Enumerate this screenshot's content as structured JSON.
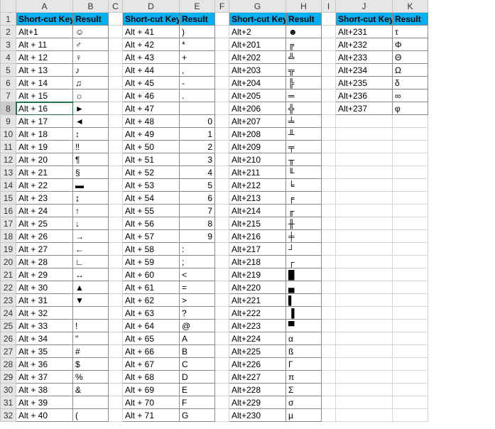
{
  "columns": [
    "A",
    "B",
    "C",
    "D",
    "E",
    "F",
    "G",
    "H",
    "I",
    "J",
    "K"
  ],
  "header_label_key": "Short-cut Key",
  "header_label_result": "Result",
  "selected_row": 8,
  "selected_col": "A",
  "blocks": [
    {
      "keycol": "A",
      "rescol": "B",
      "rows": [
        [
          "Alt+1",
          "☺"
        ],
        [
          "Alt + 11",
          "♂"
        ],
        [
          "Alt + 12",
          "♀"
        ],
        [
          "Alt + 13",
          "♪"
        ],
        [
          "Alt + 14",
          "♫"
        ],
        [
          "Alt + 15",
          "☼"
        ],
        [
          "Alt + 16",
          "►"
        ],
        [
          "Alt + 17",
          "◄"
        ],
        [
          "Alt + 18",
          "↕"
        ],
        [
          "Alt + 19",
          "‼"
        ],
        [
          "Alt + 20",
          "¶"
        ],
        [
          "Alt + 21",
          "§"
        ],
        [
          "Alt + 22",
          "▬"
        ],
        [
          "Alt + 23",
          "↨"
        ],
        [
          "Alt + 24",
          "↑"
        ],
        [
          "Alt + 25",
          "↓"
        ],
        [
          "Alt + 26",
          "→"
        ],
        [
          "Alt + 27",
          "←"
        ],
        [
          "Alt + 28",
          "∟"
        ],
        [
          "Alt + 29",
          "↔"
        ],
        [
          "Alt + 30",
          "▲"
        ],
        [
          "Alt + 31",
          "▼"
        ],
        [
          "Alt + 32",
          ""
        ],
        [
          "Alt + 33",
          "!"
        ],
        [
          "Alt + 34",
          "\""
        ],
        [
          "Alt + 35",
          "#"
        ],
        [
          "Alt + 36",
          "$"
        ],
        [
          "Alt + 37",
          "%"
        ],
        [
          "Alt + 38",
          "&"
        ],
        [
          "Alt + 39",
          ""
        ],
        [
          "Alt + 40",
          "("
        ]
      ]
    },
    {
      "keycol": "D",
      "rescol": "E",
      "rows": [
        [
          "Alt + 41",
          ")"
        ],
        [
          "Alt + 42",
          "*"
        ],
        [
          "Alt + 43",
          "+"
        ],
        [
          "Alt + 44",
          ","
        ],
        [
          "Alt + 45",
          "-"
        ],
        [
          "Alt + 46",
          "."
        ],
        [
          "Alt + 47",
          ""
        ],
        [
          "Alt + 48",
          "0"
        ],
        [
          "Alt + 49",
          "1"
        ],
        [
          "Alt + 50",
          "2"
        ],
        [
          "Alt + 51",
          "3"
        ],
        [
          "Alt + 52",
          "4"
        ],
        [
          "Alt + 53",
          "5"
        ],
        [
          "Alt + 54",
          "6"
        ],
        [
          "Alt + 55",
          "7"
        ],
        [
          "Alt + 56",
          "8"
        ],
        [
          "Alt + 57",
          "9"
        ],
        [
          "Alt + 58",
          ":"
        ],
        [
          "Alt + 59",
          ";"
        ],
        [
          "Alt + 60",
          "<"
        ],
        [
          "Alt + 61",
          "="
        ],
        [
          "Alt + 62",
          ">"
        ],
        [
          "Alt + 63",
          "?"
        ],
        [
          "Alt + 64",
          "@"
        ],
        [
          "Alt + 65",
          "A"
        ],
        [
          "Alt + 66",
          "B"
        ],
        [
          "Alt + 67",
          "C"
        ],
        [
          "Alt + 68",
          "D"
        ],
        [
          "Alt + 69",
          "E"
        ],
        [
          "Alt + 70",
          "F"
        ],
        [
          "Alt + 71",
          "G"
        ]
      ]
    },
    {
      "keycol": "G",
      "rescol": "H",
      "rows": [
        [
          "Alt+2",
          "☻"
        ],
        [
          "Alt+201",
          "╔"
        ],
        [
          "Alt+202",
          "╩"
        ],
        [
          "Alt+203",
          "╦"
        ],
        [
          "Alt+204",
          "╠"
        ],
        [
          "Alt+205",
          "═"
        ],
        [
          "Alt+206",
          "╬"
        ],
        [
          "Alt+207",
          "╧"
        ],
        [
          "Alt+208",
          "╨"
        ],
        [
          "Alt+209",
          "╤"
        ],
        [
          "Alt+210",
          "╥"
        ],
        [
          "Alt+211",
          "╙"
        ],
        [
          "Alt+212",
          "╘"
        ],
        [
          "Alt+213",
          "╒"
        ],
        [
          "Alt+214",
          "╓"
        ],
        [
          "Alt+215",
          "╫"
        ],
        [
          "Alt+216",
          "╪"
        ],
        [
          "Alt+217",
          "┘"
        ],
        [
          "Alt+218",
          "┌"
        ],
        [
          "Alt+219",
          "█"
        ],
        [
          "Alt+220",
          "▄"
        ],
        [
          "Alt+221",
          "▌"
        ],
        [
          "Alt+222",
          "▐"
        ],
        [
          "Alt+223",
          "▀"
        ],
        [
          "Alt+224",
          "α"
        ],
        [
          "Alt+225",
          "ß"
        ],
        [
          "Alt+226",
          "Γ"
        ],
        [
          "Alt+227",
          "π"
        ],
        [
          "Alt+228",
          "Σ"
        ],
        [
          "Alt+229",
          "σ"
        ],
        [
          "Alt+230",
          "µ"
        ]
      ]
    },
    {
      "keycol": "J",
      "rescol": "K",
      "rows": [
        [
          "Alt+231",
          "τ"
        ],
        [
          "Alt+232",
          "Φ"
        ],
        [
          "Alt+233",
          "Θ"
        ],
        [
          "Alt+234",
          "Ω"
        ],
        [
          "Alt+235",
          "δ"
        ],
        [
          "Alt+236",
          "∞"
        ],
        [
          "Alt+237",
          "φ"
        ]
      ]
    }
  ]
}
